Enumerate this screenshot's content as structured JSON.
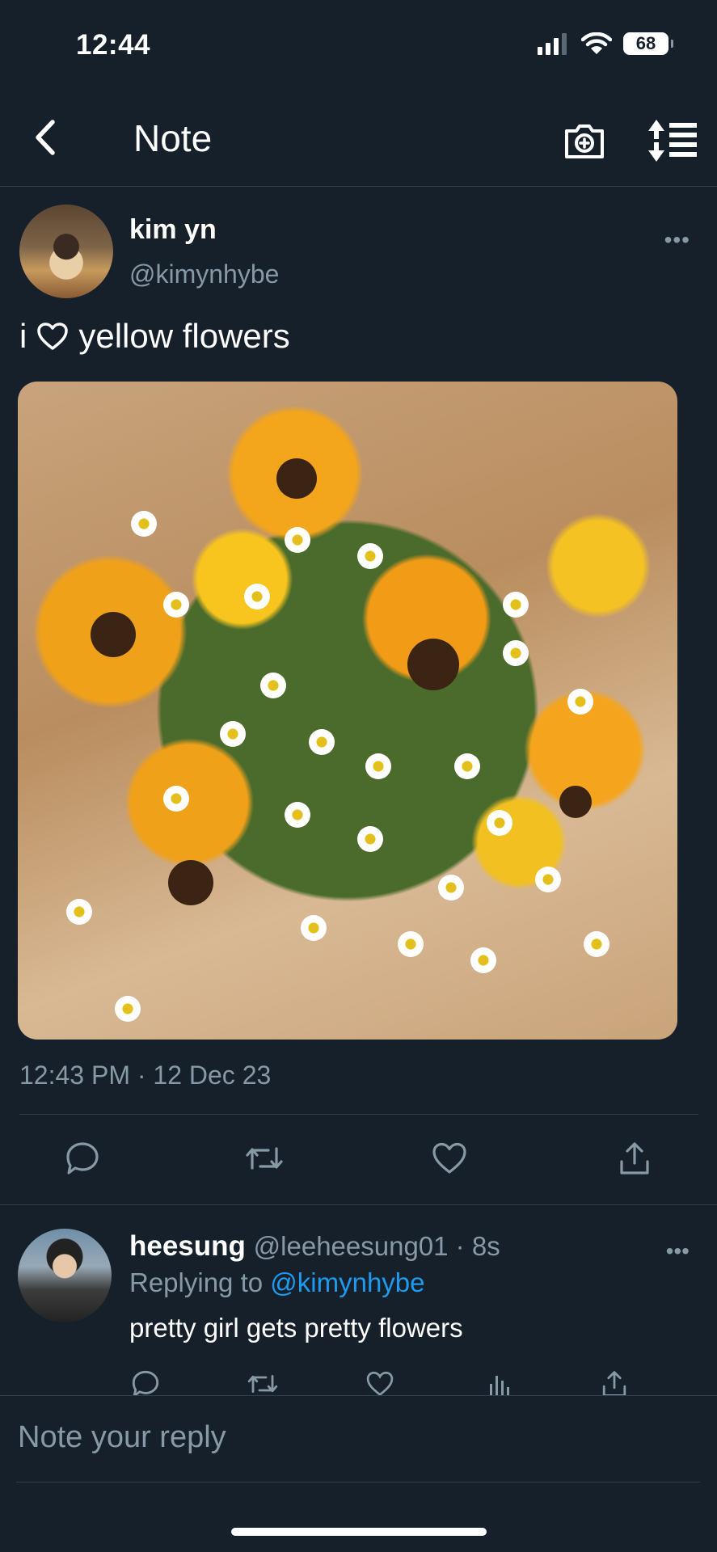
{
  "status_bar": {
    "time": "12:44",
    "battery": "68"
  },
  "nav": {
    "title": "Note"
  },
  "tweet": {
    "author_name": "kim yn",
    "author_handle": "@kimynhybe",
    "text_before": "i",
    "text_after": "yellow flowers",
    "timestamp": "12:43 PM · 12 Dec 23"
  },
  "reply": {
    "name": "heesung",
    "handle": "@leeheesung01 · 8s",
    "replying_prefix": "Replying to",
    "replying_to": "@kimynhybe",
    "text": "pretty girl gets pretty flowers"
  },
  "compose": {
    "placeholder": "Note your reply"
  },
  "colors": {
    "background": "#15202b",
    "secondary_text": "#8899a6",
    "link": "#1d9bf0",
    "divider": "#2f3e4c"
  },
  "icons": [
    "back-arrow-icon",
    "camera-icon",
    "sort-icon",
    "reply-icon",
    "retweet-icon",
    "like-icon",
    "share-icon",
    "analytics-icon",
    "heart-icon"
  ]
}
